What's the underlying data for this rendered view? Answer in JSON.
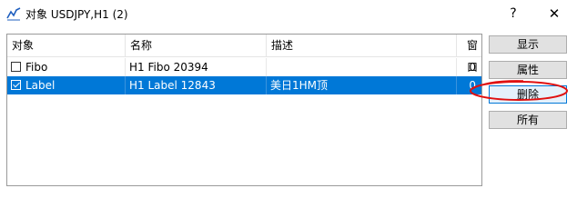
{
  "window": {
    "title": "对象 USDJPY,H1 (2)",
    "help_label": "?",
    "close_label": "✕"
  },
  "table": {
    "columns": [
      "对象",
      "名称",
      "描述",
      "窗口"
    ],
    "rows": [
      {
        "object": "Fibo",
        "name": "H1 Fibo 20394",
        "description": "",
        "window": "0",
        "checked": false,
        "selected": false
      },
      {
        "object": "Label",
        "name": "H1 Label 12843",
        "description": "美日1HM顶",
        "window": "0",
        "checked": true,
        "selected": true
      }
    ]
  },
  "buttons": {
    "show": "显示",
    "properties": "属性",
    "delete": "删除",
    "all": "所有"
  },
  "colors": {
    "selection": "#0078d7",
    "annotation": "#e01010",
    "chart_icon": "#1f5fbf"
  },
  "icons": {
    "app": "chart-line-icon",
    "help": "help-icon",
    "close": "close-icon",
    "checkbox": "checkbox-icon"
  }
}
